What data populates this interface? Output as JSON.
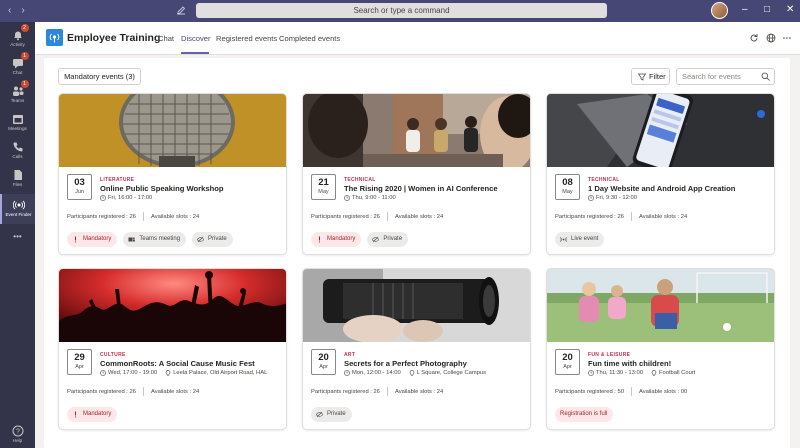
{
  "topbar": {
    "search_placeholder": "Search or type a command",
    "nav_back": "‹",
    "nav_forward": "›",
    "minimize": "–",
    "maximize": "□",
    "close": "✕"
  },
  "rail": {
    "items": [
      {
        "label": "Activity",
        "icon": "bell-icon",
        "badge": "2"
      },
      {
        "label": "Chat",
        "icon": "chat-icon",
        "badge": "1"
      },
      {
        "label": "Teams",
        "icon": "teams-icon",
        "badge": "1"
      },
      {
        "label": "Meetings",
        "icon": "calendar-icon",
        "badge": ""
      },
      {
        "label": "Calls",
        "icon": "phone-icon",
        "badge": ""
      },
      {
        "label": "Files",
        "icon": "file-icon",
        "badge": ""
      },
      {
        "label": "Event Finder",
        "icon": "broadcast-icon",
        "badge": ""
      }
    ],
    "more": "•••",
    "help": "Help"
  },
  "app": {
    "title": "Employee Training",
    "tabs": [
      "Chat",
      "Discover",
      "Registered events",
      "Completed events"
    ],
    "active_tab": "Discover"
  },
  "toolbar": {
    "mandatory_label": "Mandatory events (3)",
    "filter_label": "Filter",
    "search_placeholder": "Search for events"
  },
  "colors": {
    "rail": "#33344a",
    "topbar": "#464775",
    "accent": "#6264a7",
    "category": "#c4314b",
    "mandatory_tag_bg": "#fde7e9"
  },
  "events": [
    {
      "day": "03",
      "month": "Jun",
      "category": "LITERATURE",
      "title": "Online Public Speaking Workshop",
      "time": "Fri, 16:00 - 17:00",
      "location": "",
      "registered": "Participants registered : 26",
      "slots": "Available slots : 24",
      "tags": [
        {
          "label": "Mandatory",
          "icon": "exclamation-icon",
          "style": "red"
        },
        {
          "label": "Teams meeting",
          "icon": "teams-meeting-icon",
          "style": ""
        },
        {
          "label": "Private",
          "icon": "eye-off-icon",
          "style": ""
        }
      ]
    },
    {
      "day": "21",
      "month": "May",
      "category": "TECHNICAL",
      "title": "The Rising 2020 | Women in AI Conference",
      "time": "Thu, 9:00 - 11:00",
      "location": "",
      "registered": "Participants registered : 26",
      "slots": "Available slots : 24",
      "tags": [
        {
          "label": "Mandatory",
          "icon": "exclamation-icon",
          "style": "red"
        },
        {
          "label": "Private",
          "icon": "eye-off-icon",
          "style": ""
        }
      ]
    },
    {
      "day": "08",
      "month": "May",
      "category": "TECHNICAL",
      "title": "1 Day Website and Android App Creation",
      "time": "Fri, 9:30 - 12:00",
      "location": "",
      "registered": "Participants registered : 26",
      "slots": "Available slots : 24",
      "tags": [
        {
          "label": "Live event",
          "icon": "broadcast-icon",
          "style": ""
        }
      ]
    },
    {
      "day": "29",
      "month": "Apr",
      "category": "CULTURE",
      "title": "CommonRoots: A Social Cause Music Fest",
      "time": "Wed, 17:00 - 19:00",
      "location": "Leela Palace, Old Airport Road, HAL",
      "registered": "Participants registered : 26",
      "slots": "Available slots : 24",
      "tags": [
        {
          "label": "Mandatory",
          "icon": "exclamation-icon",
          "style": "red"
        }
      ]
    },
    {
      "day": "20",
      "month": "Apr",
      "category": "ART",
      "title": "Secrets for a Perfect Photography",
      "time": "Mon, 12:00 - 14:00",
      "location": "L Square, College Campus",
      "registered": "Participants registered : 26",
      "slots": "Available slots : 24",
      "tags": [
        {
          "label": "Private",
          "icon": "eye-off-icon",
          "style": ""
        }
      ]
    },
    {
      "day": "20",
      "month": "Apr",
      "category": "FUN & LEISURE",
      "title": "Fun time with children!",
      "time": "Thu, 11:30 - 13:00",
      "location": "Football Court",
      "registered": "Participants registered : 50",
      "slots": "Available slots : 00",
      "tags": [
        {
          "label": "Registration is full",
          "icon": "",
          "style": "red"
        }
      ]
    }
  ]
}
